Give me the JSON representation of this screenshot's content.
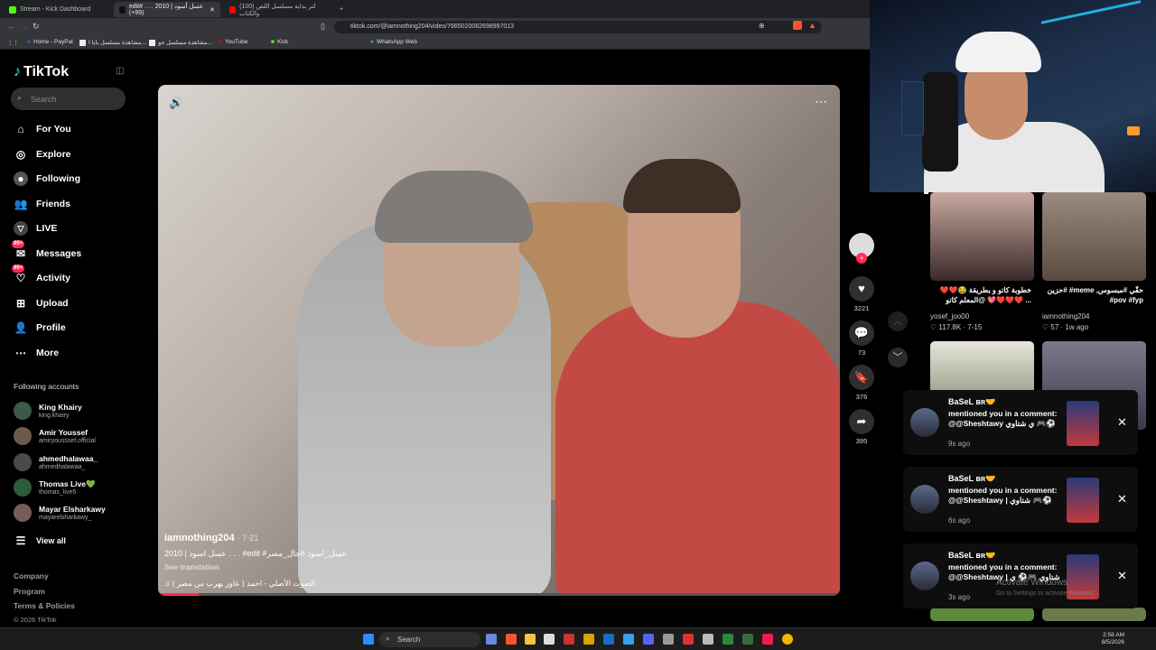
{
  "browser": {
    "tabs": [
      {
        "label": "Stream - Kick Dashboard"
      },
      {
        "label": "edit# . . . 2010 | عسل أسود (99+)"
      },
      {
        "label": "(100) لتر بداية مسلسل اللص والكتاب"
      }
    ],
    "url": "tiktok.com/@iamnothing204/video/7665020082698997013",
    "bookmarks": [
      "Home - PayPal",
      "مشاهدة مسلسل بابا ا...",
      "مشاهدة مسلسل جو...",
      "YouTube",
      "Kick",
      "WhatsApp Web"
    ]
  },
  "sidebar": {
    "logo": "TikTok",
    "search_placeholder": "Search",
    "nav": [
      {
        "label": "For You",
        "icon": "home-icon"
      },
      {
        "label": "Explore",
        "icon": "compass-icon"
      },
      {
        "label": "Following",
        "icon": "following-icon"
      },
      {
        "label": "Friends",
        "icon": "friends-icon"
      },
      {
        "label": "LIVE",
        "icon": "live-icon"
      },
      {
        "label": "Messages",
        "icon": "messages-icon",
        "badge": "99+"
      },
      {
        "label": "Activity",
        "icon": "activity-icon",
        "badge": "99+"
      },
      {
        "label": "Upload",
        "icon": "upload-icon"
      },
      {
        "label": "Profile",
        "icon": "profile-icon"
      },
      {
        "label": "More",
        "icon": "more-icon"
      }
    ],
    "following_header": "Following accounts",
    "following": [
      {
        "name": "King Khairy",
        "handle": "king.khairy"
      },
      {
        "name": "Amir Youssef",
        "handle": "amiryousssef.official"
      },
      {
        "name": "ahmedhalawaa_",
        "handle": "ahmedhalawaa_"
      },
      {
        "name": "Thomas Live💚",
        "handle": "thomas_live5"
      },
      {
        "name": "Mayar Elsharkawy",
        "handle": "mayarelsharkawy_"
      }
    ],
    "view_all": "View all",
    "footer": [
      "Company",
      "Program",
      "Terms & Policies",
      "© 2026 TikTok"
    ]
  },
  "video": {
    "username": "iamnothing204",
    "date": "· 7-21",
    "description": "2010 | عسل اسود . . . #edit #عسل_اسود #حال_مصر",
    "see_translation": "See translation",
    "sound": "الصوت الأصلي - احمد ( عاوز يهرب من مصر )",
    "progress_fraction": 0.06
  },
  "actions": {
    "likes": "3221",
    "comments": "73",
    "saves": "376",
    "shares": "395"
  },
  "right_videos": [
    {
      "caption": "خطوبة كاتو و بطريقة 😂❤️❤️ @المعلم كاتو 💖❤️❤️❤️ ...",
      "user": "yosef_joo00",
      "meta": "♡ 117.8K · 7-15"
    },
    {
      "caption": "حزين# #meme ,حقّي #مبسوس #pov #fyp",
      "user": "iamnothing204",
      "meta": "♡ 57 · 1w ago"
    }
  ],
  "notifications": [
    {
      "name": "BaSeL ʙʀ🤝",
      "message": "mentioned you in a comment: @@Sheshtawy ي شتاوي 🎮⚽",
      "time": "9s ago"
    },
    {
      "name": "BaSeL ʙʀ🤝",
      "message": "mentioned you in a comment: @@Sheshtawy | شتاوي 🎮⚽",
      "time": "6s ago"
    },
    {
      "name": "BaSeL ʙʀ🤝",
      "message": "mentioned you in a comment: @@Sheshtawy | شتاوي 🎮⚽ ي",
      "time": "3s ago"
    }
  ],
  "watermark": {
    "title": "Activate Windows",
    "sub": "Go to Settings to activate Windows."
  },
  "taskbar": {
    "search": "Search",
    "time": "2:58 AM",
    "date": "8/5/2026"
  }
}
